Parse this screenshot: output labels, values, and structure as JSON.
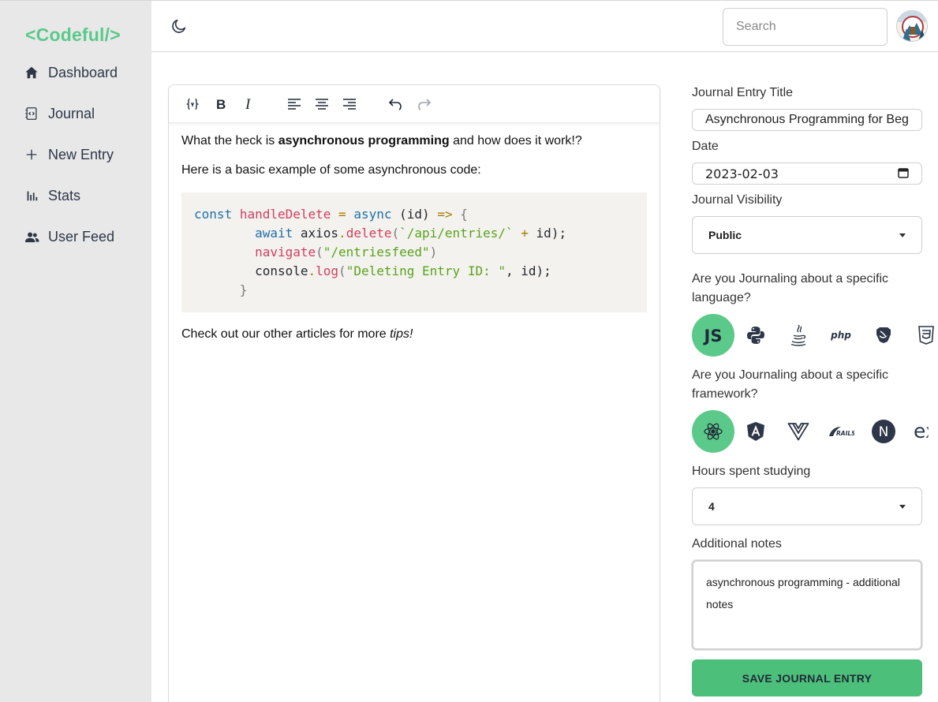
{
  "brand": "<Codeful/>",
  "nav": [
    {
      "label": "Dashboard",
      "icon": "home-icon"
    },
    {
      "label": "Journal",
      "icon": "journal-icon"
    },
    {
      "label": "New Entry",
      "icon": "plus-icon"
    },
    {
      "label": "Stats",
      "icon": "bar-chart-icon"
    },
    {
      "label": "User Feed",
      "icon": "users-icon"
    }
  ],
  "topbar": {
    "search_placeholder": "Search",
    "theme_icon": "moon-icon",
    "avatar_icon": "avatar"
  },
  "editor": {
    "toolbar": [
      "code-block-icon",
      "bold-icon",
      "italic-icon",
      "align-left-icon",
      "align-center-icon",
      "align-right-icon",
      "undo-icon",
      "redo-icon"
    ],
    "p1_before": "What the heck is ",
    "p1_bold": "asynchronous programming",
    "p1_after": " and how does it work!?",
    "p2": "Here is a basic example of some asynchronous code:",
    "code": {
      "l1_kw": "const",
      "l1_fn": "handleDelete",
      "l1_eq": "=",
      "l1_async": "async",
      "l1_param": "(id)",
      "l1_arrow": "=>",
      "l1_brace": "{",
      "l2_await": "await",
      "l2_obj": "axios",
      "l2_method": "delete",
      "l2_str": "`/api/entries/`",
      "l2_plus": "+",
      "l2_rest": "id);",
      "l3_fn": "navigate",
      "l3_str": "\"/entriesfeed\"",
      "l4_obj": "console",
      "l4_method": "log",
      "l4_str": "\"Deleting Entry ID: \"",
      "l4_rest": ", id);",
      "l5": "}"
    },
    "p3_before": "Check out our other articles for more ",
    "p3_italic": "tips!"
  },
  "form": {
    "title_label": "Journal Entry Title",
    "title_value": "Asynchronous Programming for Beg",
    "date_label": "Date",
    "date_value": "2023-02-03",
    "visibility_label": "Journal Visibility",
    "visibility_value": "Public",
    "language_label": "Are you Journaling about a specific language?",
    "languages": [
      "javascript",
      "python",
      "java",
      "php",
      "swift",
      "css3"
    ],
    "language_selected": "javascript",
    "js_text": "JS",
    "php_text": "php",
    "framework_label": "Are you Journaling about a specific framework?",
    "frameworks": [
      "react",
      "angular",
      "vue",
      "rails",
      "nextjs",
      "express"
    ],
    "framework_selected": "react",
    "rails_text": "RAILS",
    "next_text": "N",
    "express_text": "ex",
    "hours_label": "Hours spent studying",
    "hours_value": "4",
    "notes_label": "Additional notes",
    "notes_value": "asynchronous programming - additional notes",
    "save_label": "SAVE JOURNAL ENTRY"
  },
  "colors": {
    "accent": "#5bc98a",
    "save_button": "#4cc07a",
    "sidebar_bg": "#e8e8e8",
    "code_bg": "#f4f2ef"
  }
}
